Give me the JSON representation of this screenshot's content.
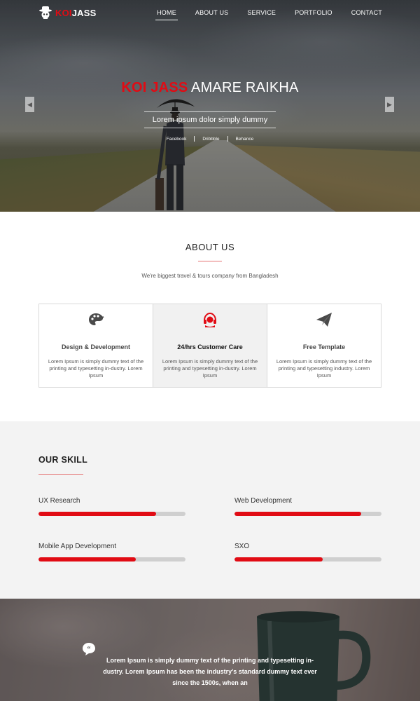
{
  "brand": {
    "word1": "KOI",
    "word2": "JASS",
    "logo_icon": "skull-hat-icon",
    "accent": "#e10b14"
  },
  "nav": {
    "items": [
      {
        "label": "HOME",
        "active": true
      },
      {
        "label": "ABOUT US",
        "active": false
      },
      {
        "label": "SERVICE",
        "active": false
      },
      {
        "label": "PORTFOLIO",
        "active": false
      },
      {
        "label": "CONTACT",
        "active": false
      }
    ]
  },
  "hero": {
    "title_red": "KOI JASS",
    "title_white": "AMARE RAIKHA",
    "subtitle": "Lorem ipsum dolor simply dummy",
    "social": [
      "Facebook",
      "Dribbble",
      "Behance"
    ],
    "prev_icon": "chevron-left-icon",
    "next_icon": "chevron-right-icon"
  },
  "about": {
    "title": "ABOUT US",
    "description": "We're biggest travel & tours company from Bangladesh",
    "cards": [
      {
        "title": "Design & Development",
        "text": "Lorem Ipsum is simply dummy text of the printing and typesetting in-dustry. Lorem Ipsum",
        "icon": "palette-icon"
      },
      {
        "title": "24/hrs Customer Care",
        "text": "Lorem Ipsum is simply dummy text of the printing and typesetting in-dustry. Lorem Ipsum",
        "icon": "headset-icon"
      },
      {
        "title": "Free Template",
        "text": "Lorem Ipsum is simply dummy text of the printing and typesetting industry. Lorem Ipsum",
        "icon": "paper-plane-icon"
      }
    ]
  },
  "skills": {
    "title": "OUR SKILL",
    "items": [
      {
        "label": "UX Research",
        "percent": 80
      },
      {
        "label": "Web Development",
        "percent": 86
      },
      {
        "label": "Mobile App Development",
        "percent": 66
      },
      {
        "label": "SXO",
        "percent": 60
      }
    ]
  },
  "testimonial": {
    "text": "Lorem Ipsum is simply dummy text of the printing and typesetting in-dustry. Lorem Ipsum has been the industry's standard dummy text ever since the 1500s, when an",
    "icon": "quote-bubble-icon"
  }
}
